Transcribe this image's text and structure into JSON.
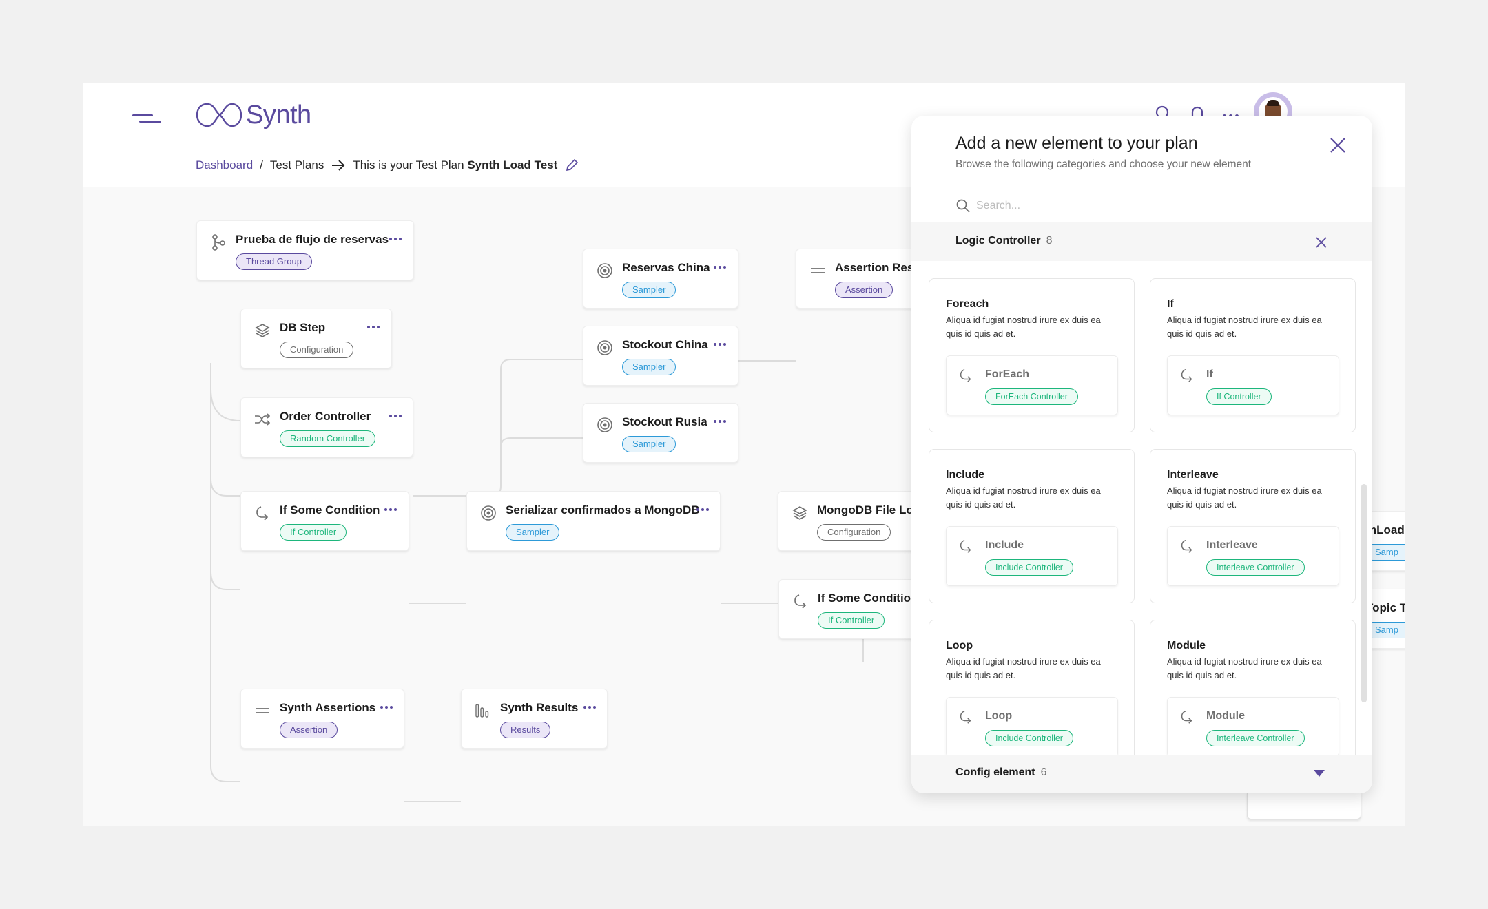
{
  "app": {
    "name": "Synth",
    "brand_color": "#5a4a9e"
  },
  "header": {
    "menu_icon": "hamburger-menu-icon",
    "icons": [
      "search-icon",
      "notification-bell-icon",
      "more-dots-icon"
    ],
    "avatar_alt": "User avatar"
  },
  "breadcrumb": {
    "dashboard": "Dashboard",
    "separator": "/",
    "test_plans": "Test Plans",
    "arrow": "→",
    "prefix": "This is your Test Plan",
    "plan_name": "Synth Load Test",
    "edit_icon": "pencil-icon"
  },
  "nodes": [
    {
      "title": "Prueba de flujo de reservas",
      "tag": "Thread Group",
      "icon": "branch-icon"
    },
    {
      "title": "DB Step",
      "tag": "Configuration",
      "icon": "layers-icon"
    },
    {
      "title": "Order Controller",
      "tag": "Random Controller",
      "icon": "shuffle-icon"
    },
    {
      "title": "If Some Condition",
      "tag": "If Controller",
      "icon": "condition-arrow-icon"
    },
    {
      "title": "Synth Assertions",
      "tag": "Assertion",
      "icon": "equals-icon"
    },
    {
      "title": "Synth Results",
      "tag": "Results",
      "icon": "bar-chart-icon"
    },
    {
      "title": "Reservas China",
      "tag": "Sampler",
      "icon": "target-icon"
    },
    {
      "title": "Stockout China",
      "tag": "Sampler",
      "icon": "target-icon"
    },
    {
      "title": "Stockout Rusia",
      "tag": "Sampler",
      "icon": "target-icon"
    },
    {
      "title": "Assertion Rese",
      "tag": "Assertion",
      "icon": "equals-icon"
    },
    {
      "title": "Serializar confirmados a MongoDB",
      "tag": "Sampler",
      "icon": "target-icon"
    },
    {
      "title": "MongoDB File Load",
      "tag": "Configuration",
      "icon": "layers-icon"
    },
    {
      "title": "If Some Condition",
      "tag": "If Controller",
      "icon": "condition-arrow-icon"
    },
    {
      "title": "mLoad",
      "tag": "Samp",
      "icon": "target-icon"
    },
    {
      "title": "Topic T",
      "tag": "Samp",
      "icon": "target-icon"
    }
  ],
  "panel": {
    "title": "Add a new element to your plan",
    "subtitle": "Browse the following categories and choose your new element",
    "search_placeholder": "Search...",
    "search_value": "",
    "open_category": {
      "name": "Logic Controller",
      "count": "8"
    },
    "cards": [
      {
        "title": "Foreach",
        "desc": "Aliqua id fugiat nostrud irure ex duis ea quis id quis ad et.",
        "element": "ForEach",
        "tag": "ForEach Controller"
      },
      {
        "title": "If",
        "desc": "Aliqua id fugiat nostrud irure ex duis ea quis id quis ad et.",
        "element": "If",
        "tag": "If Controller"
      },
      {
        "title": "Include",
        "desc": "Aliqua id fugiat nostrud irure ex duis ea quis id quis ad et.",
        "element": "Include",
        "tag": "Include Controller"
      },
      {
        "title": "Interleave",
        "desc": "Aliqua id fugiat nostrud irure ex duis ea quis id quis ad et.",
        "element": "Interleave",
        "tag": "Interleave Controller"
      },
      {
        "title": "Loop",
        "desc": "Aliqua id fugiat nostrud irure ex duis ea quis id quis ad et.",
        "element": "Loop",
        "tag": "Include Controller"
      },
      {
        "title": "Module",
        "desc": "Aliqua id fugiat nostrud irure ex duis ea quis id quis ad et.",
        "element": "Module",
        "tag": "Interleave Controller"
      }
    ],
    "next_category": {
      "name": "Config element",
      "count": "6"
    }
  }
}
